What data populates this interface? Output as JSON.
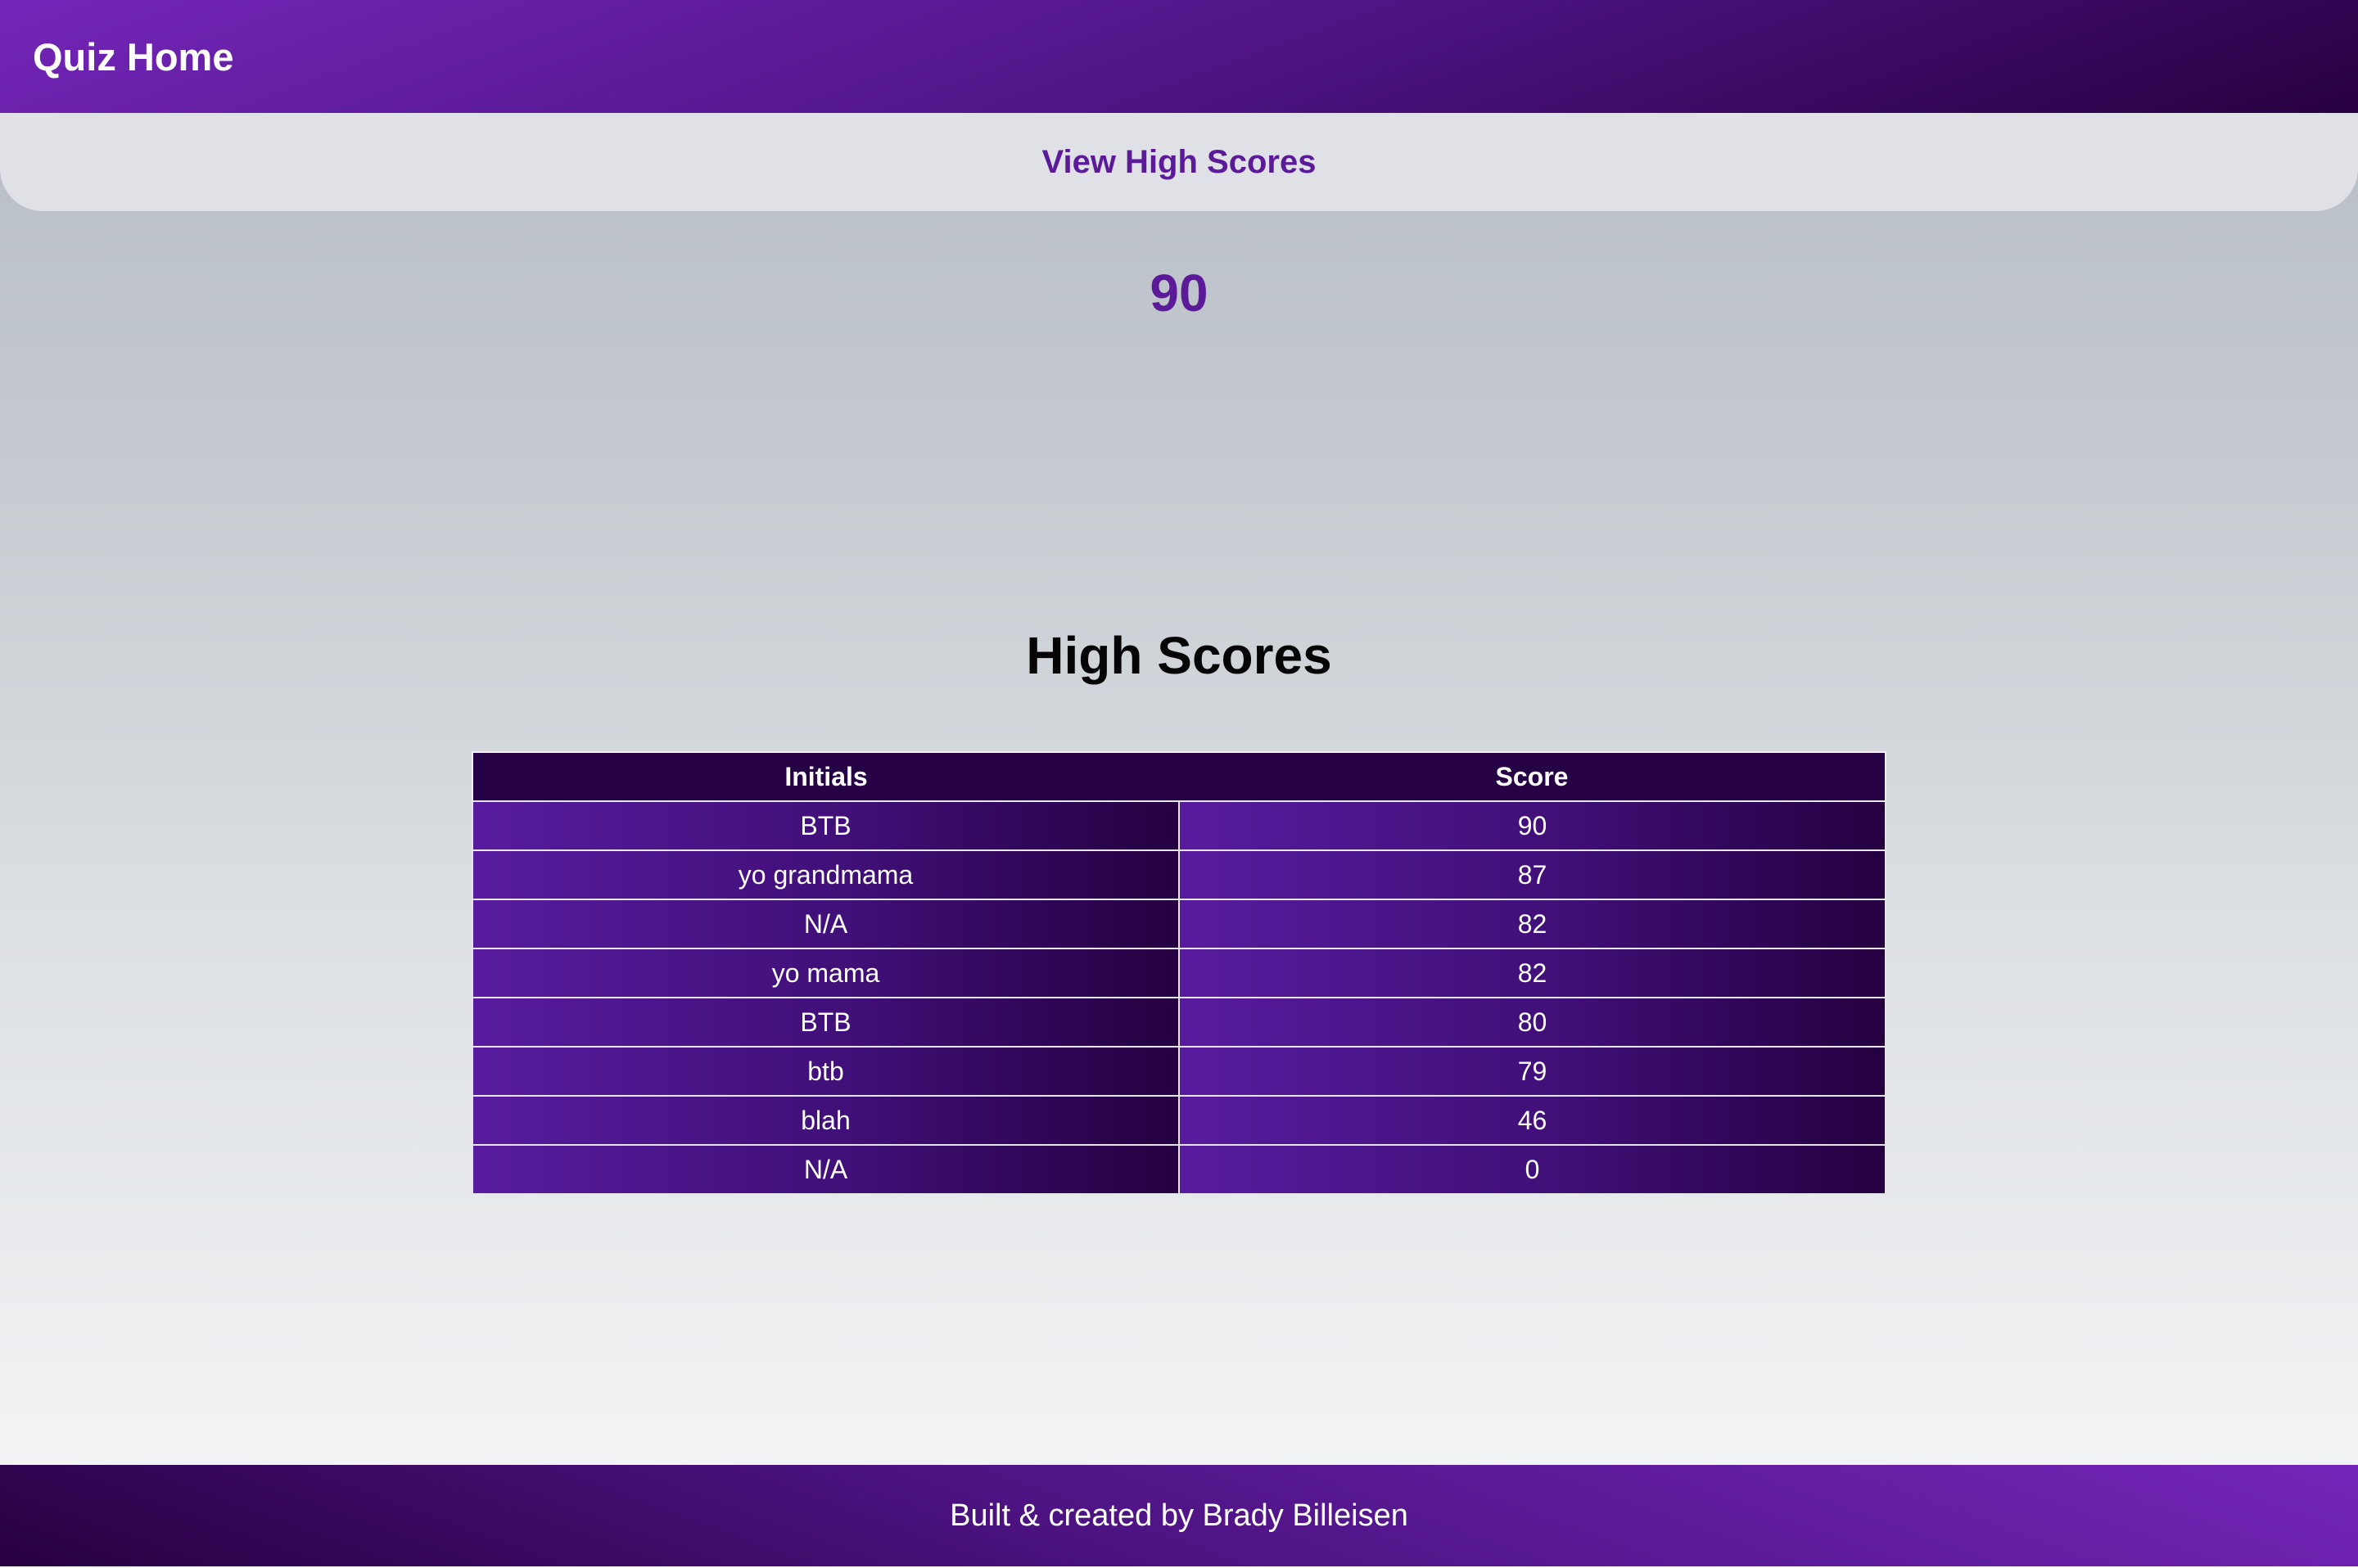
{
  "header": {
    "title": "Quiz Home"
  },
  "nav": {
    "view_high_scores": "View High Scores"
  },
  "main": {
    "current_score": "90",
    "high_scores_title": "High Scores"
  },
  "table": {
    "headers": [
      "Initials",
      "Score"
    ],
    "rows": [
      {
        "initials": "BTB",
        "score": "90"
      },
      {
        "initials": "yo grandmama",
        "score": "87"
      },
      {
        "initials": "N/A",
        "score": "82"
      },
      {
        "initials": "yo mama",
        "score": "82"
      },
      {
        "initials": "BTB",
        "score": "80"
      },
      {
        "initials": "btb",
        "score": "79"
      },
      {
        "initials": "blah",
        "score": "46"
      },
      {
        "initials": "N/A",
        "score": "0"
      }
    ]
  },
  "footer": {
    "credit": "Built & created by Brady Billeisen"
  },
  "colors": {
    "brand_purple": "#5b1a97",
    "header_dark": "#260044",
    "header_light": "#7326b8"
  }
}
